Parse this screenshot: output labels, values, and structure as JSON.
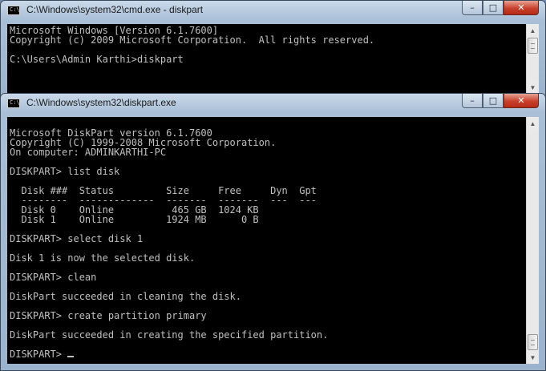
{
  "windows": [
    {
      "title": "C:\\Windows\\system32\\cmd.exe - diskpart",
      "icon": "cmd-icon",
      "lines": [
        "Microsoft Windows [Version 6.1.7600]",
        "Copyright (c) 2009 Microsoft Corporation.  All rights reserved.",
        "",
        "C:\\Users\\Admin Karthi>diskpart"
      ]
    },
    {
      "title": "C:\\Windows\\system32\\diskpart.exe",
      "icon": "cmd-icon",
      "lines": [
        "",
        "Microsoft DiskPart version 6.1.7600",
        "Copyright (C) 1999-2008 Microsoft Corporation.",
        "On computer: ADMINKARTHI-PC",
        "",
        "DISKPART> list disk",
        "",
        "  Disk ###  Status         Size     Free     Dyn  Gpt",
        "  --------  -------------  -------  -------  ---  ---",
        "  Disk 0    Online          465 GB  1024 KB",
        "  Disk 1    Online         1924 MB      0 B",
        "",
        "DISKPART> select disk 1",
        "",
        "Disk 1 is now the selected disk.",
        "",
        "DISKPART> clean",
        "",
        "DiskPart succeeded in cleaning the disk.",
        "",
        "DISKPART> create partition primary",
        "",
        "DiskPart succeeded in creating the specified partition.",
        "",
        "DISKPART> "
      ]
    }
  ],
  "window_controls": {
    "minimize": "–",
    "maximize": "□",
    "close": "✕"
  },
  "scroll_arrows": {
    "up": "▲",
    "down": "▼"
  }
}
